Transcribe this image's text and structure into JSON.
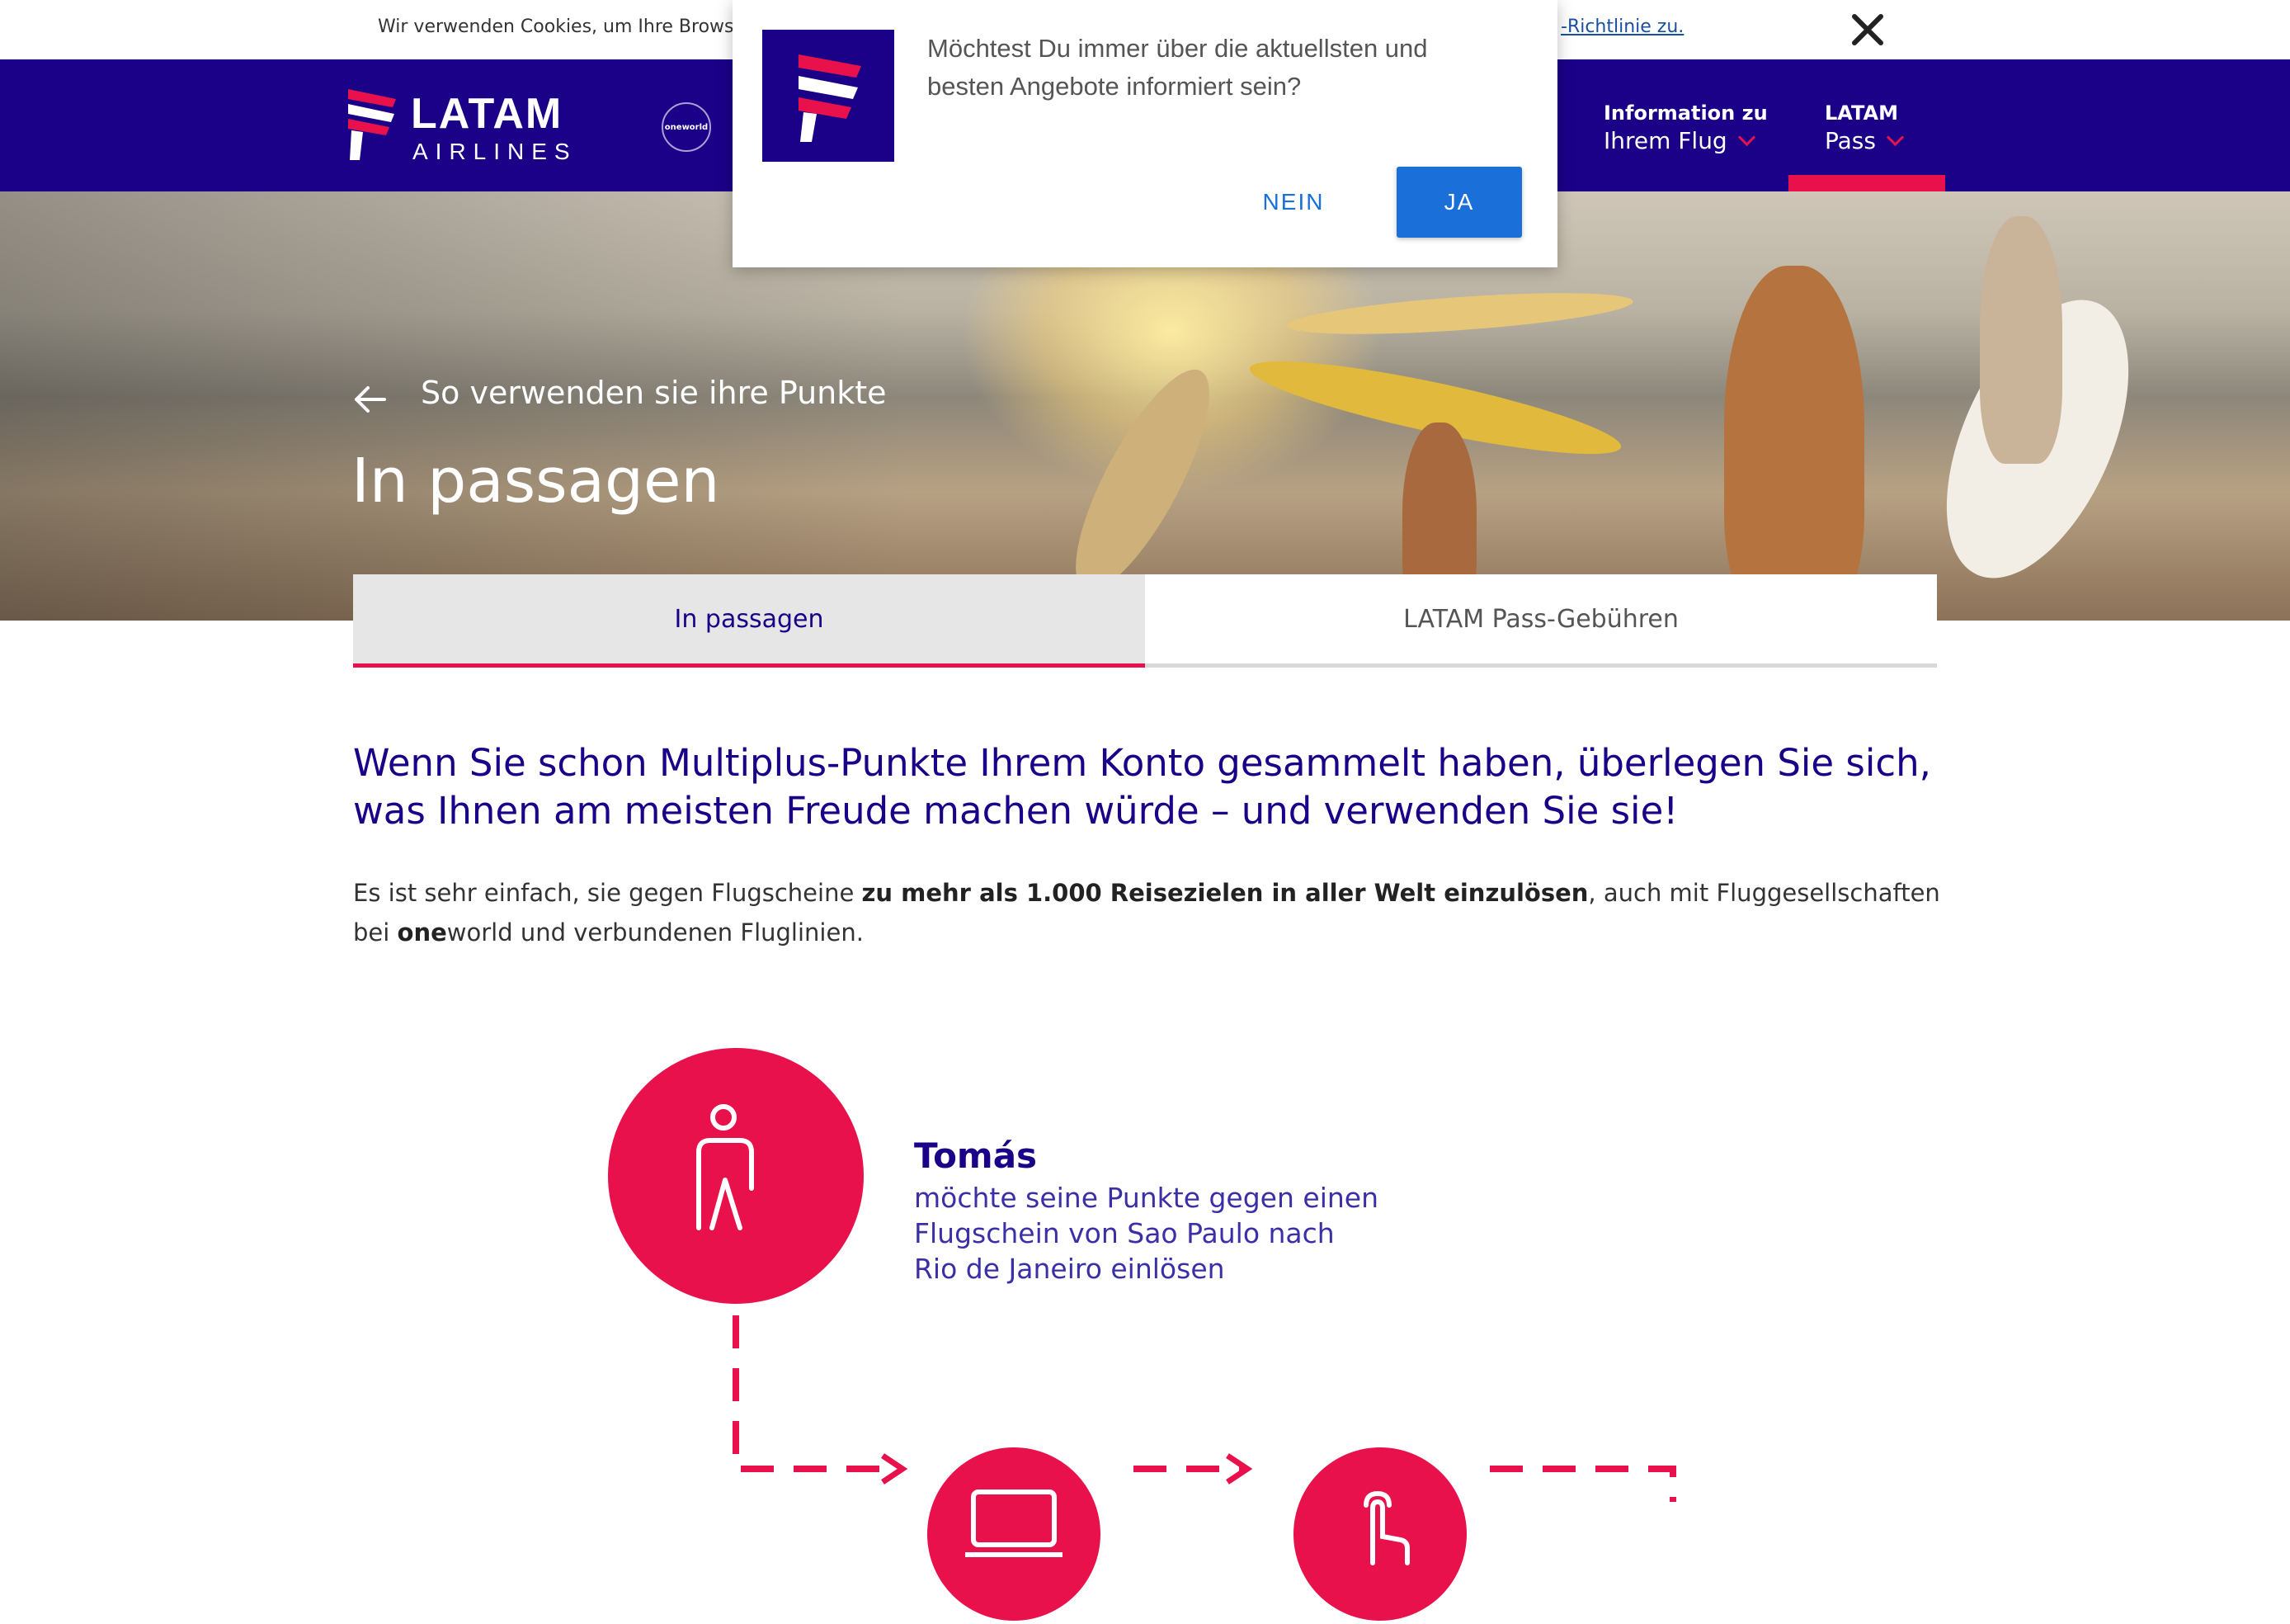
{
  "cookie": {
    "text": "Wir verwenden Cookies, um Ihre Browser-",
    "link": "-Richtlinie zu."
  },
  "header": {
    "logo_main": "LATAM",
    "logo_sub": "AIRLINES",
    "alliance": "oneworld",
    "nav": [
      {
        "line1": "Information zu",
        "line2": "Ihrem Flug"
      },
      {
        "line1": "LATAM",
        "line2": "Pass"
      }
    ]
  },
  "hero": {
    "back_label": "So verwenden sie ihre Punkte",
    "title": "In passagen"
  },
  "tabs": [
    {
      "label": "In passagen",
      "active": true
    },
    {
      "label": "LATAM Pass-Gebühren",
      "active": false
    }
  ],
  "content": {
    "lead": "Wenn Sie schon Multiplus-Punkte Ihrem Konto gesammelt haben, überlegen Sie sich, was Ihnen am meisten Freude machen würde – und verwenden Sie sie!",
    "body_pre": "Es ist sehr einfach, sie gegen Flugscheine ",
    "body_bold": "zu mehr als 1.000 Reisezielen in aller Welt einzulösen",
    "body_mid": ", auch mit Fluggesellschaften bei ",
    "body_one": "one",
    "body_end": "world und verbundenen Fluglinien."
  },
  "infographic": {
    "name": "Tomás",
    "line1": "möchte seine Punkte gegen einen",
    "line2": "Flugschein von Sao Paulo nach",
    "line3": "Rio de Janeiro einlösen"
  },
  "popup": {
    "message": "Möchtest Du immer über die aktuellsten und besten Angebote informiert sein?",
    "no_label": "NEIN",
    "yes_label": "JA"
  },
  "colors": {
    "brand_indigo": "#1b0088",
    "brand_coral": "#e8114b",
    "button_blue": "#1a6fd8"
  },
  "icons": [
    "close-icon",
    "chevron-down-icon",
    "arrow-left-icon",
    "person-icon",
    "laptop-icon",
    "touch-icon"
  ]
}
